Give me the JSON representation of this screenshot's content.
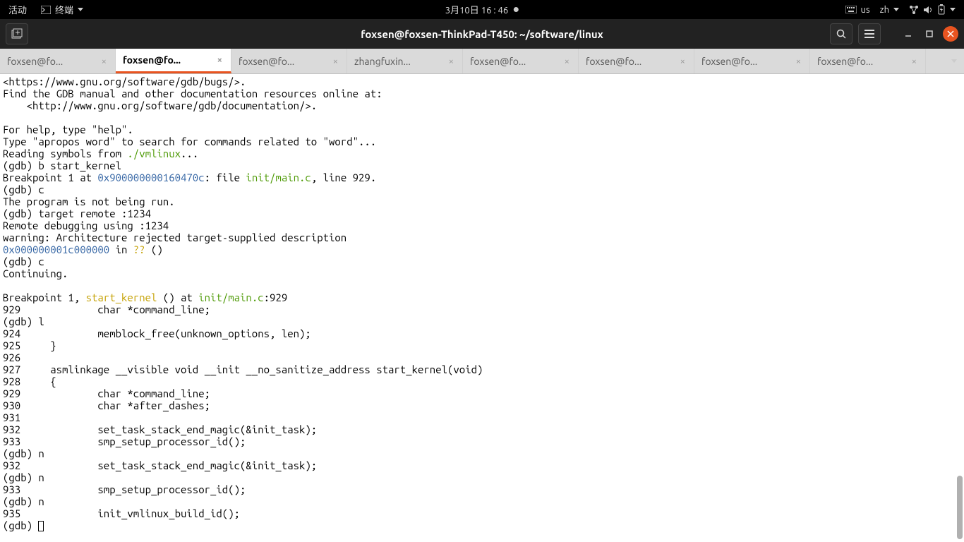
{
  "topbar": {
    "activities": "活动",
    "app": "终端",
    "datetime": "3月10日  16 : 46",
    "kb": "us",
    "lang": "zh"
  },
  "titlebar": {
    "title": "foxsen@foxsen-ThinkPad-T450: ~/software/linux"
  },
  "tabs": [
    {
      "label": "foxsen@fo..."
    },
    {
      "label": "foxsen@fo..."
    },
    {
      "label": "foxsen@fo..."
    },
    {
      "label": "zhangfuxin..."
    },
    {
      "label": "foxsen@fo..."
    },
    {
      "label": "foxsen@fo..."
    },
    {
      "label": "foxsen@fo..."
    },
    {
      "label": "foxsen@fo..."
    }
  ],
  "term": {
    "l0": "<https://www.gnu.org/software/gdb/bugs/>.",
    "l1": "Find the GDB manual and other documentation resources online at:",
    "l2": "    <http://www.gnu.org/software/gdb/documentation/>.",
    "l3": "",
    "l4": "For help, type \"help\".",
    "l5": "Type \"apropos word\" to search for commands related to \"word\"...",
    "l6a": "Reading symbols from ",
    "l6b": "./vmlinux",
    "l6c": "...",
    "l7": "(gdb) b start_kernel",
    "l8a": "Breakpoint 1 at ",
    "l8b": "0x900000000160470c",
    "l8c": ": file ",
    "l8d": "init/main.c",
    "l8e": ", line 929.",
    "l9": "(gdb) c",
    "l10": "The program is not being run.",
    "l11": "(gdb) target remote :1234",
    "l12": "Remote debugging using :1234",
    "l13": "warning: Architecture rejected target-supplied description",
    "l14a": "0x000000001c000000",
    "l14b": " in ",
    "l14c": "??",
    "l14d": " ()",
    "l15": "(gdb) c",
    "l16": "Continuing.",
    "l17": "",
    "l18a": "Breakpoint 1, ",
    "l18b": "start_kernel",
    "l18c": " () at ",
    "l18d": "init/main.c",
    "l18e": ":929",
    "l19": "929             char *command_line;",
    "l20": "(gdb) l",
    "l21": "924             memblock_free(unknown_options, len);",
    "l22": "925     }",
    "l23": "926",
    "l24": "927     asmlinkage __visible void __init __no_sanitize_address start_kernel(void)",
    "l25": "928     {",
    "l26": "929             char *command_line;",
    "l27": "930             char *after_dashes;",
    "l28": "931",
    "l29": "932             set_task_stack_end_magic(&init_task);",
    "l30": "933             smp_setup_processor_id();",
    "l31": "(gdb) n",
    "l32": "932             set_task_stack_end_magic(&init_task);",
    "l33": "(gdb) n",
    "l34": "933             smp_setup_processor_id();",
    "l35": "(gdb) n",
    "l36": "935             init_vmlinux_build_id();",
    "l37": "(gdb) "
  }
}
